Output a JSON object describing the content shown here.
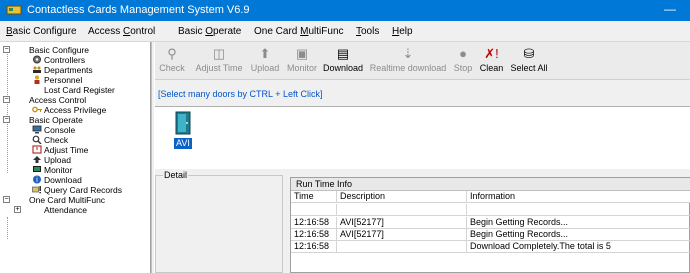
{
  "window": {
    "title": "Contactless Cards Management System  V6.9",
    "minimize_glyph": "—",
    "icon": "card-reader-icon"
  },
  "menu": {
    "items": [
      {
        "pre": "",
        "u": "B",
        "post": "asic Configure"
      },
      {
        "pre": "Access ",
        "u": "C",
        "post": "ontrol"
      },
      {
        "pre": "Basic ",
        "u": "O",
        "post": "perate"
      },
      {
        "pre": "One Card ",
        "u": "M",
        "post": "ultiFunc"
      },
      {
        "pre": "",
        "u": "T",
        "post": "ools"
      },
      {
        "pre": "",
        "u": "H",
        "post": "elp"
      }
    ]
  },
  "tree": {
    "items": [
      {
        "label": "Basic Configure",
        "level": 0,
        "expander": "−"
      },
      {
        "label": "Controllers",
        "level": 1,
        "icon": "controllers-icon"
      },
      {
        "label": "Departments",
        "level": 1,
        "icon": "departments-icon"
      },
      {
        "label": "Personnel",
        "level": 1,
        "icon": "personnel-icon"
      },
      {
        "label": "Lost Card Register",
        "level": 1,
        "icon": ""
      },
      {
        "label": "Access Control",
        "level": 0,
        "expander": "−"
      },
      {
        "label": "Access Privilege",
        "level": 1,
        "icon": "key-icon"
      },
      {
        "label": "Basic Operate",
        "level": 0,
        "expander": "−"
      },
      {
        "label": "Console",
        "level": 1,
        "icon": "console-icon"
      },
      {
        "label": "Check",
        "level": 1,
        "icon": "check-icon"
      },
      {
        "label": "Adjust Time",
        "level": 1,
        "icon": "adjust-time-icon"
      },
      {
        "label": "Upload",
        "level": 1,
        "icon": "upload-icon"
      },
      {
        "label": "Monitor",
        "level": 1,
        "icon": "monitor-icon"
      },
      {
        "label": "Download",
        "level": 1,
        "icon": "download-icon"
      },
      {
        "label": "Query Card Records",
        "level": 1,
        "icon": "query-records-icon"
      },
      {
        "label": "One Card MultiFunc",
        "level": 0,
        "expander": "−"
      },
      {
        "label": "Attendance",
        "level": 1,
        "expander": "+"
      }
    ]
  },
  "toolbar": {
    "buttons": [
      {
        "label": "Check",
        "glyph": "⚲",
        "enabled": false,
        "icon": "check-icon"
      },
      {
        "label": "Adjust Time",
        "glyph": "◫",
        "enabled": false,
        "icon": "adjust-time-icon"
      },
      {
        "label": "Upload",
        "glyph": "⬆",
        "enabled": false,
        "icon": "upload-icon"
      },
      {
        "label": "Monitor",
        "glyph": "▣",
        "enabled": false,
        "icon": "monitor-icon"
      },
      {
        "label": "Download",
        "glyph": "▤",
        "enabled": true,
        "icon": "download-icon"
      },
      {
        "label": "Realtime download",
        "glyph": "⇣",
        "enabled": false,
        "icon": "realtime-download-icon"
      },
      {
        "label": "Stop",
        "glyph": "●",
        "enabled": false,
        "icon": "stop-icon"
      },
      {
        "label": "Clean",
        "glyph": "✗!",
        "enabled": true,
        "icon": "clean-icon"
      },
      {
        "label": "Select All",
        "glyph": "⛁",
        "enabled": true,
        "icon": "select-all-icon"
      }
    ]
  },
  "hint": "[Select many doors by CTRL + Left Click]",
  "doors": [
    {
      "label": "AVI",
      "selected": true,
      "icon": "door-icon"
    }
  ],
  "detail": {
    "legend": "Detail"
  },
  "runtime": {
    "caption": "Run Time Info",
    "columns": [
      "Time",
      "Description",
      "Information"
    ],
    "rows": [
      [
        "",
        "",
        ""
      ],
      [
        "12:16:58",
        "AVI[52177]",
        "Begin Getting Records..."
      ],
      [
        "12:16:58",
        "AVI[52177]",
        "Begin Getting Records..."
      ],
      [
        "12:16:58",
        "",
        "Download Completely.The total is  5"
      ]
    ]
  },
  "colors": {
    "titlebar": "#0078d7",
    "selection": "#0a64c8",
    "hint_text": "#0055cc"
  }
}
